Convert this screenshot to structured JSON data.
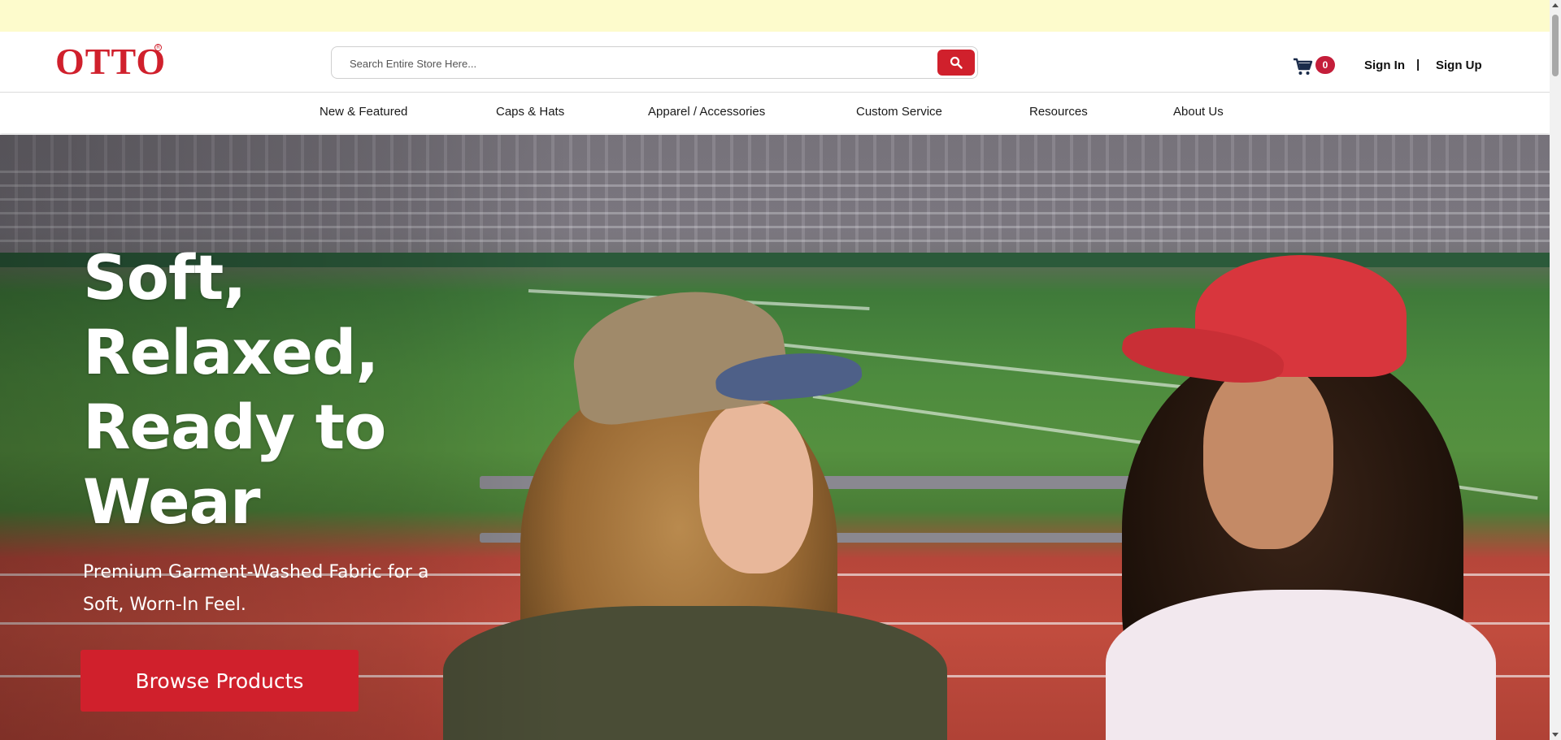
{
  "brand": {
    "logo_text": "OTTO",
    "registered_mark": "R",
    "accent_color": "#d0202c"
  },
  "search": {
    "placeholder": "Search Entire Store Here...",
    "button_icon": "search-icon"
  },
  "cart": {
    "icon": "cart-icon",
    "count": "0"
  },
  "auth": {
    "sign_in": "Sign In",
    "separator": "|",
    "sign_up": "Sign Up"
  },
  "nav": {
    "items": [
      {
        "label": "New & Featured"
      },
      {
        "label": "Caps & Hats"
      },
      {
        "label": "Apparel / Accessories"
      },
      {
        "label": "Custom Service"
      },
      {
        "label": "Resources"
      },
      {
        "label": "About Us"
      }
    ]
  },
  "hero": {
    "title": "Soft, Relaxed, Ready to Wear",
    "subtitle": "Premium Garment-Washed Fabric for a Soft, Worn-In Feel.",
    "cta_label": "Browse Products"
  }
}
